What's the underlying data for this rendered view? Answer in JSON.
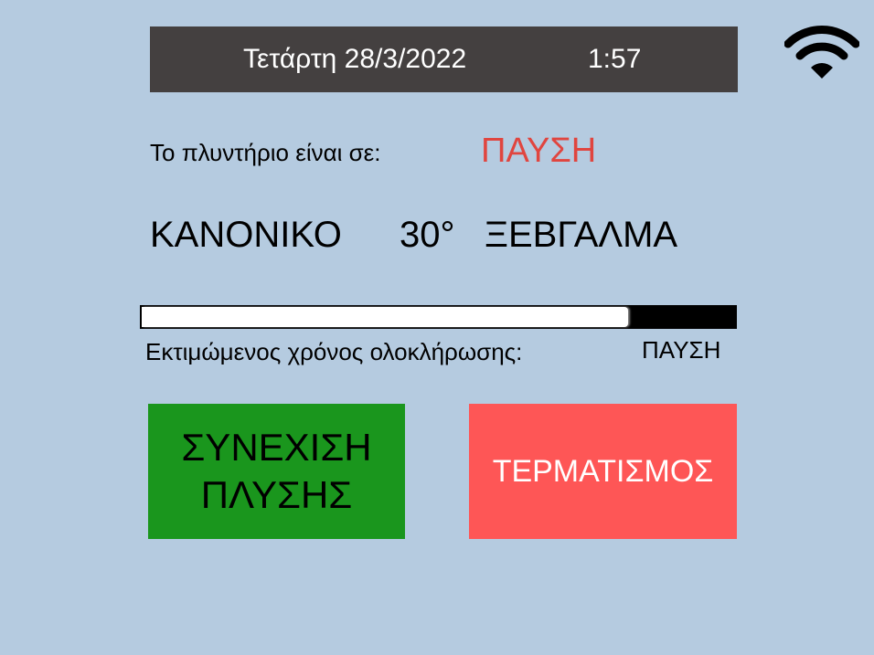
{
  "header": {
    "date": "Τετάρτη 28/3/2022",
    "time": "1:57",
    "wifi_icon": "wifi-icon"
  },
  "status": {
    "label": "Το πλυντήριο είναι σε:",
    "value": "ΠΑΥΣΗ",
    "value_color": "#e0453f"
  },
  "program": {
    "mode": "ΚΑΝΟΝΙΚΟ",
    "temperature": "30°",
    "phase": "ΞΕΒΓΑΛΜΑ"
  },
  "progress": {
    "fraction": 0.82
  },
  "eta": {
    "label": "Εκτιμώμενος χρόνος ολοκλήρωσης:",
    "value": "ΠΑΥΣΗ"
  },
  "buttons": {
    "continue_line1": "ΣΥΝΕΧΙΣΗ",
    "continue_line2": "ΠΛΥΣΗΣ",
    "continue_color": "#1a961d",
    "stop_label": "ΤΕΡΜΑΤΙΣΜΟΣ",
    "stop_color": "#fe5656"
  }
}
